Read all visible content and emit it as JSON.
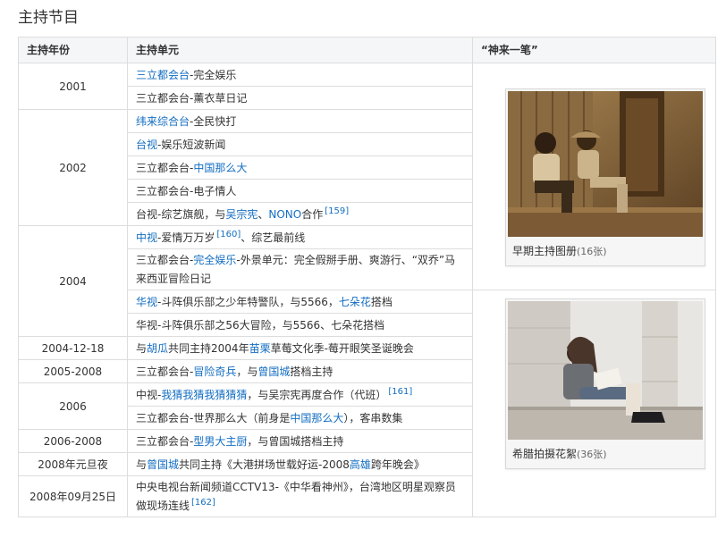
{
  "section_title": "主持节目",
  "headers": {
    "year": "主持年份",
    "program": "主持单元",
    "gallery": "“神来一笔”"
  },
  "rows": {
    "r1": {
      "year": "2001",
      "a": "三立都会台",
      "b": "-完全娱乐"
    },
    "r2": {
      "text": "三立都会台-薰衣草日记"
    },
    "r3": {
      "year": "2002",
      "a": "纬来综合台",
      "b": "-全民快打"
    },
    "r4": {
      "a": "台视",
      "b": "-娱乐短波新闻"
    },
    "r5": {
      "a": "三立都会台-",
      "b": "中国那么大"
    },
    "r6": {
      "text": "三立都会台-电子情人"
    },
    "r7": {
      "a": "台视-综艺旗舰，与",
      "b": "吴宗宪",
      "c": "、",
      "d": "NONO",
      "e": "合作",
      "ref": "[159]"
    },
    "r8": {
      "year": "2004",
      "a": "中视",
      "b": "-爱情万万岁",
      "ref": "[160]",
      "c": "、综艺最前线"
    },
    "r9": {
      "a": "三立都会台-",
      "b": "完全娱乐",
      "c": "-外景单元：完全假掰手册、爽游行、“双乔”马来西亚冒险日记"
    },
    "r10": {
      "a": "华视",
      "b": "-斗阵俱乐部之少年特警队，与5566，",
      "c": "七朵花",
      "d": "搭档"
    },
    "r11": {
      "text": "华视-斗阵俱乐部之56大冒险，与5566、七朵花搭档"
    },
    "r12": {
      "year": "2004-12-18",
      "a": "与",
      "b": "胡瓜",
      "c": "共同主持2004年",
      "d": "苗栗",
      "e": "草莓文化季-莓开眼笑圣诞晚会"
    },
    "r13": {
      "year": "2005-2008",
      "a": "三立都会台-",
      "b": "冒险奇兵",
      "c": "，与",
      "d": "曾国城",
      "e": "搭档主持"
    },
    "r14": {
      "year": "2006",
      "a": "中视-",
      "b": "我猜我猜我猜猜猜",
      "c": "，与吴宗宪再度合作（代班）",
      "ref": "[161]"
    },
    "r15": {
      "a": "三立都会台-世界那么大（前身是",
      "b": "中国那么大",
      "c": "），客串数集"
    },
    "r16": {
      "year": "2006-2008",
      "a": "三立都会台-",
      "b": "型男大主厨",
      "c": "，与曾国城搭档主持"
    },
    "r17": {
      "year": "2008年元旦夜",
      "a": "与",
      "b": "曾国城",
      "c": "共同主持《大港拼场世载好运-2008",
      "d": "高雄",
      "e": "跨年晚会》"
    },
    "r18": {
      "year": "2008年09月25日",
      "text": "中央电视台新闻频道CCTV13-《中华看神州》，台湾地区明星观察员做现场连线",
      "ref": "[162]"
    }
  },
  "gallery": {
    "item1": {
      "caption": "早期主持图册",
      "count": "(16张)"
    },
    "item2": {
      "caption": "希腊拍摄花絮",
      "count": "(36张)"
    }
  },
  "colors": {
    "link": "#136ec2",
    "header_bg": "#f5f6f8",
    "border": "#dddddd"
  }
}
